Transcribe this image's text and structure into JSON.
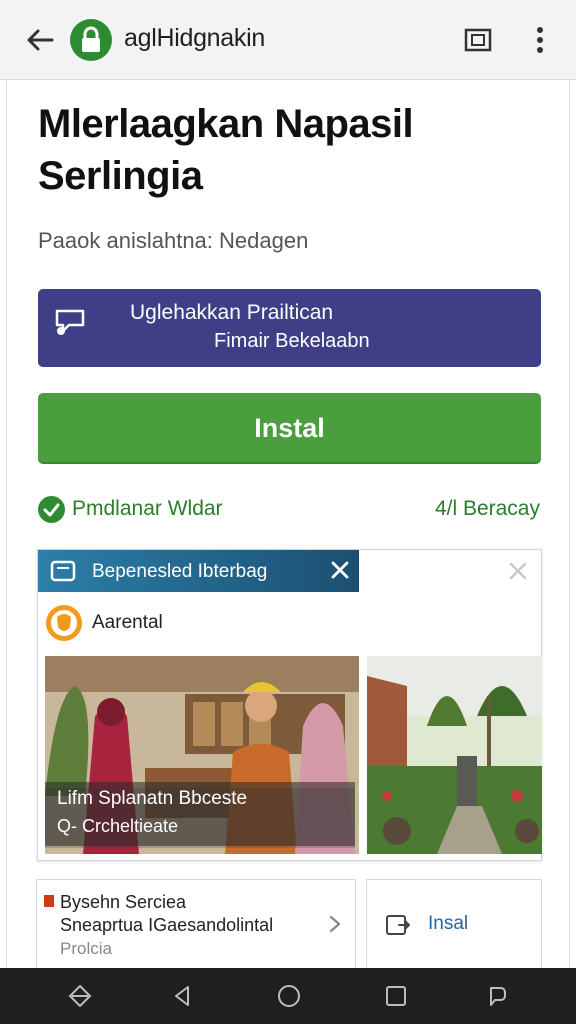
{
  "browser": {
    "url": "aglHidgnakin",
    "icons": {
      "back": "arrow-left-icon",
      "site": "lock-icon",
      "tabs": "tab-switcher-icon",
      "menu": "more-vert-icon"
    }
  },
  "page": {
    "title": "Mlerlaagkan Napasil Serlingia",
    "subtitle": "Paaok anislahtna: Nedagen"
  },
  "promo": {
    "line1": "Uglehakkan Prailtican",
    "line2": "Fimair Bekelaabn",
    "color": "#3e3f86",
    "icon": "chat-bubble-icon"
  },
  "install_button": {
    "label": "Instal",
    "color": "#4a9e3e"
  },
  "status": {
    "verified_label": "Pmdlanar Wldar",
    "rating": "4/l Beracay",
    "icon": "check-circle-icon"
  },
  "ad": {
    "tab_label": "Bepenesled Ibterbag",
    "advertiser_name": "Aarental",
    "caption_line1": "Lifm Splanatn Bbceste",
    "caption_line2": "Q- Crcheltieate",
    "icons": {
      "tab": "window-icon",
      "tab_close": "close-icon",
      "card_close": "close-icon",
      "advertiser": "brand-logo-icon"
    }
  },
  "info_card": {
    "title": "Bysehn Serciea",
    "description": "Sneaprtua IGaesandolintal",
    "footer": "Prolcia"
  },
  "instal_card": {
    "label": "Insal",
    "icon": "open-external-icon"
  },
  "navbar": {
    "icons": [
      "diamond-nav-icon",
      "back-triangle-icon",
      "home-circle-icon",
      "recents-square-icon",
      "assistant-icon"
    ]
  }
}
